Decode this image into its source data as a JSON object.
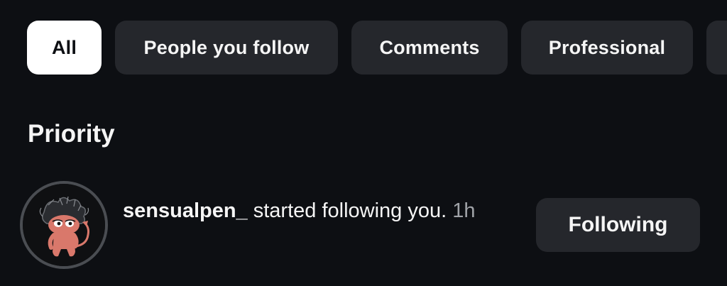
{
  "filters": {
    "items": [
      {
        "label": "All",
        "active": true
      },
      {
        "label": "People you follow",
        "active": false
      },
      {
        "label": "Comments",
        "active": false
      },
      {
        "label": "Professional",
        "active": false
      }
    ]
  },
  "section": {
    "title": "Priority"
  },
  "notification": {
    "avatar_icon": "cartoon-devil-character-avatar",
    "username": "sensualpen_",
    "action_text": " started following you.",
    "time": "1h",
    "button_label": "Following"
  },
  "colors": {
    "background": "#0d0f13",
    "chip_bg": "#25272c",
    "chip_active_bg": "#ffffff",
    "text": "#f5f5f5",
    "muted_text": "#a0a3a8"
  }
}
